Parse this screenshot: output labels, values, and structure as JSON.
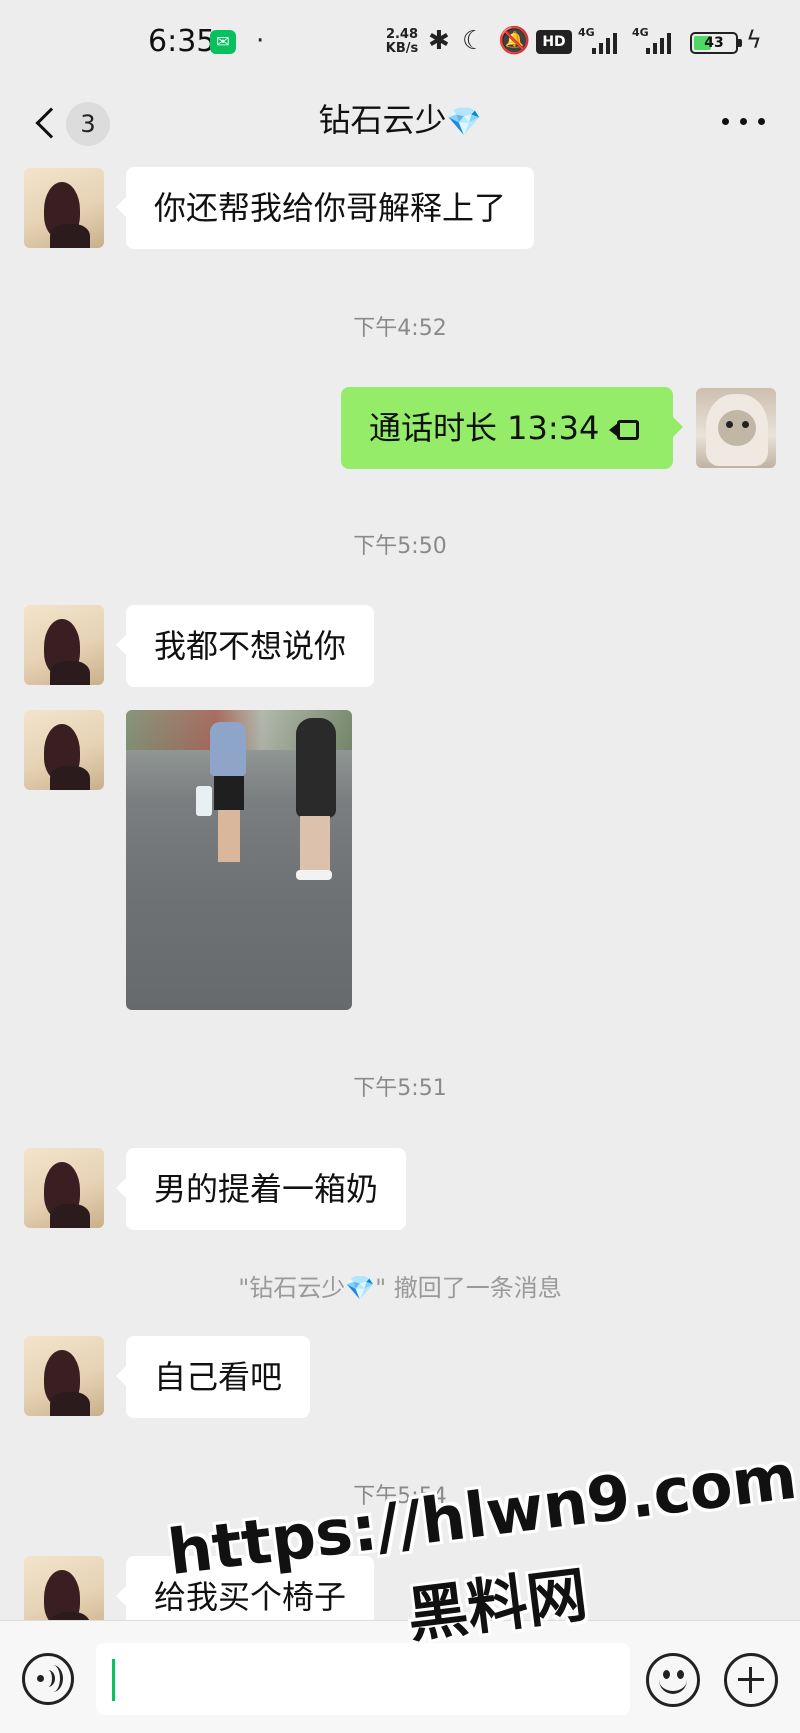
{
  "status_bar": {
    "time": "6:35",
    "notification_icon": "wechat-icon",
    "dot": "·",
    "net_speed_value": "2.48",
    "net_speed_unit": "KB/s",
    "hd_label": "HD",
    "network_type_1": "4G",
    "network_type_2": "4G",
    "battery_level": "43",
    "battery_fraction": 0.43
  },
  "header": {
    "back_badge": "3",
    "title": "钻石云少",
    "title_emoji": "💎",
    "more_icon": "more-icon"
  },
  "messages": [
    {
      "type": "text",
      "from": "other",
      "text": "你还帮我给你哥解释上了"
    },
    {
      "type": "time",
      "text": "下午4:52"
    },
    {
      "type": "call",
      "from": "me",
      "text": "通话时长 13:34"
    },
    {
      "type": "time",
      "text": "下午5:50"
    },
    {
      "type": "text",
      "from": "other",
      "text": "我都不想说你"
    },
    {
      "type": "image",
      "from": "other"
    },
    {
      "type": "time",
      "text": "下午5:51"
    },
    {
      "type": "text",
      "from": "other",
      "text": "男的提着一箱奶"
    },
    {
      "type": "recall",
      "text": "\"钻石云少💎\" 撤回了一条消息"
    },
    {
      "type": "text",
      "from": "other",
      "text": "自己看吧"
    },
    {
      "type": "time",
      "text": "下午5:54"
    },
    {
      "type": "text",
      "from": "other",
      "text": "给我买个椅子"
    }
  ],
  "input_bar": {
    "voice_icon": "voice-icon",
    "input_value": "",
    "emoji_icon": "emoji-icon",
    "plus_icon": "plus-icon"
  },
  "watermark": {
    "url": "https://hlwn9.com",
    "site_name": "黑料网"
  },
  "colors": {
    "background": "#ededed",
    "my_bubble": "#95ec69",
    "other_bubble": "#ffffff",
    "accent_green": "#07c160"
  }
}
